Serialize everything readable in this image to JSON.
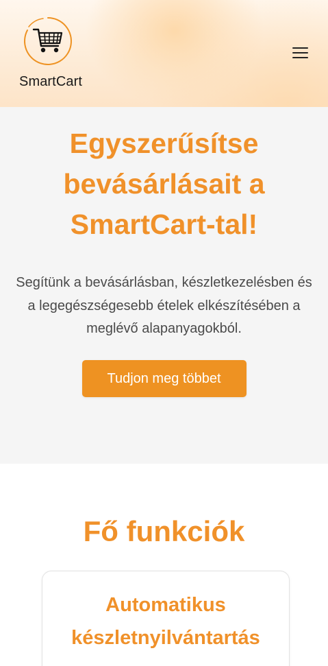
{
  "header": {
    "brand": "SmartCart",
    "logo_icon": "shopping-cart-icon",
    "menu_icon": "hamburger-menu-icon"
  },
  "hero": {
    "title": "Egyszerűsítse bevásárlásait a SmartCart-tal!",
    "description": "Segítünk a bevásárlásban, készletkezelésben és a legegészségesebb ételek elkészítésében a meglévő alapanyagokból.",
    "cta_label": "Tudjon meg többet"
  },
  "features": {
    "title": "Fő funkciók",
    "items": [
      {
        "title": "Automatikus készletnyilvántartás"
      }
    ]
  },
  "colors": {
    "accent": "#ee9222",
    "heading": "#f0912a",
    "hero_bg": "#f5f5f5",
    "body_text": "#4a4a4a"
  }
}
